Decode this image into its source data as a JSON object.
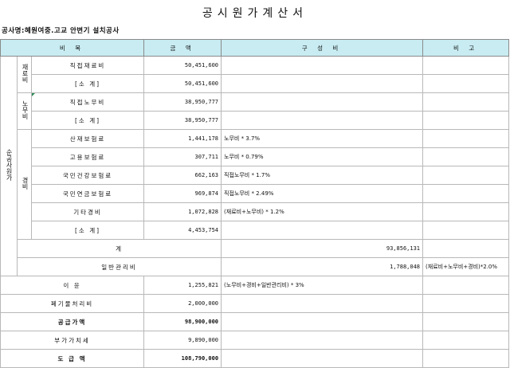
{
  "title": "공시원가계산서",
  "project": "공사명:혜원여중.고교 안변기 설치공사",
  "header": {
    "item": "비 목",
    "amount": "금 액",
    "composition": "구 성 비",
    "remarks": "비 고"
  },
  "group_label": "순공사원가",
  "material": {
    "label": "재료비",
    "rows": [
      {
        "name": "직접재료비",
        "amount": "50,451,600"
      },
      {
        "name": "[소 계]",
        "amount": "50,451,600"
      }
    ]
  },
  "labor": {
    "label": "노무비",
    "rows": [
      {
        "name": "직접노무비",
        "amount": "38,950,777"
      },
      {
        "name": "[소 계]",
        "amount": "38,950,777"
      }
    ]
  },
  "expense": {
    "label": "경비",
    "rows": [
      {
        "name": "산재보험료",
        "amount": "1,441,178",
        "note": "노무비 * 3.7%"
      },
      {
        "name": "고용보험료",
        "amount": "307,711",
        "note": "노무비 * 0.79%"
      },
      {
        "name": "국민건강보험료",
        "amount": "662,163",
        "note": "직접노무비 * 1.7%"
      },
      {
        "name": "국민연금보험료",
        "amount": "969,874",
        "note": "직접노무비 * 2.49%"
      },
      {
        "name": "기타경비",
        "amount": "1,072,828",
        "note": "(재료비+노무비) * 1.2%"
      },
      {
        "name": "[소 계]",
        "amount": "4,453,754",
        "note": ""
      }
    ]
  },
  "summary": [
    {
      "name": "계",
      "amount": "93,856,131",
      "note": "",
      "bold": false
    },
    {
      "name": "일반관리비",
      "amount": "1,788,048",
      "note": "(재료비+노무비+경비)*2.0%",
      "bold": false
    },
    {
      "name": "이 윤",
      "amount": "1,255,821",
      "note": "(노무비+경비+일반관리비) * 3%",
      "bold": false
    },
    {
      "name": "폐기물처리비",
      "amount": "2,000,000",
      "note": "",
      "bold": false
    },
    {
      "name": "공급가액",
      "amount": "98,900,000",
      "note": "",
      "bold": true
    },
    {
      "name": "부가가치세",
      "amount": "9,890,000",
      "note": "",
      "bold": false
    },
    {
      "name": "도 급 액",
      "amount": "108,790,000",
      "note": "",
      "bold": true
    }
  ]
}
